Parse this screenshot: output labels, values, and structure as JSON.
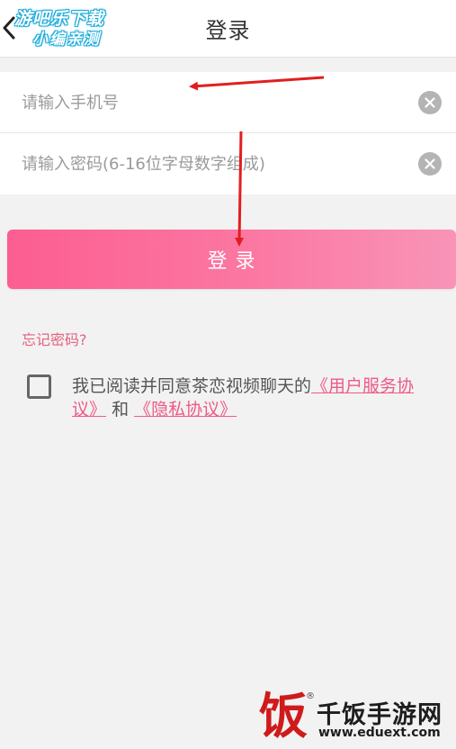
{
  "header": {
    "title": "登录",
    "back_icon": "chevron-left-icon"
  },
  "watermark_top": {
    "line1": "游吧乐下载",
    "line2": "小编亲测"
  },
  "form": {
    "phone_placeholder": "请输入手机号",
    "phone_value": "",
    "password_placeholder": "请输入密码(6-16位字母数字组成)",
    "password_value": "",
    "clear_icon": "clear-circle-icon"
  },
  "login_button_label": "登 录",
  "forgot_password": "忘记密码?",
  "agreement": {
    "checked": false,
    "prefix": "我已阅读并同意茶恋视频聊天的",
    "user_agreement": "《用户服务协议》",
    "conjunction": "和",
    "privacy_policy": "《隐私协议》"
  },
  "watermark_bottom": {
    "logo_glyph": "饭",
    "registered": "®",
    "name": "千饭手游网",
    "url": "www.eduext.com"
  },
  "colors": {
    "accent_pink": "#fc5e91",
    "link_pink": "#ee5a86",
    "arrow_red": "#e01f1f",
    "background": "#f2f2f2"
  }
}
